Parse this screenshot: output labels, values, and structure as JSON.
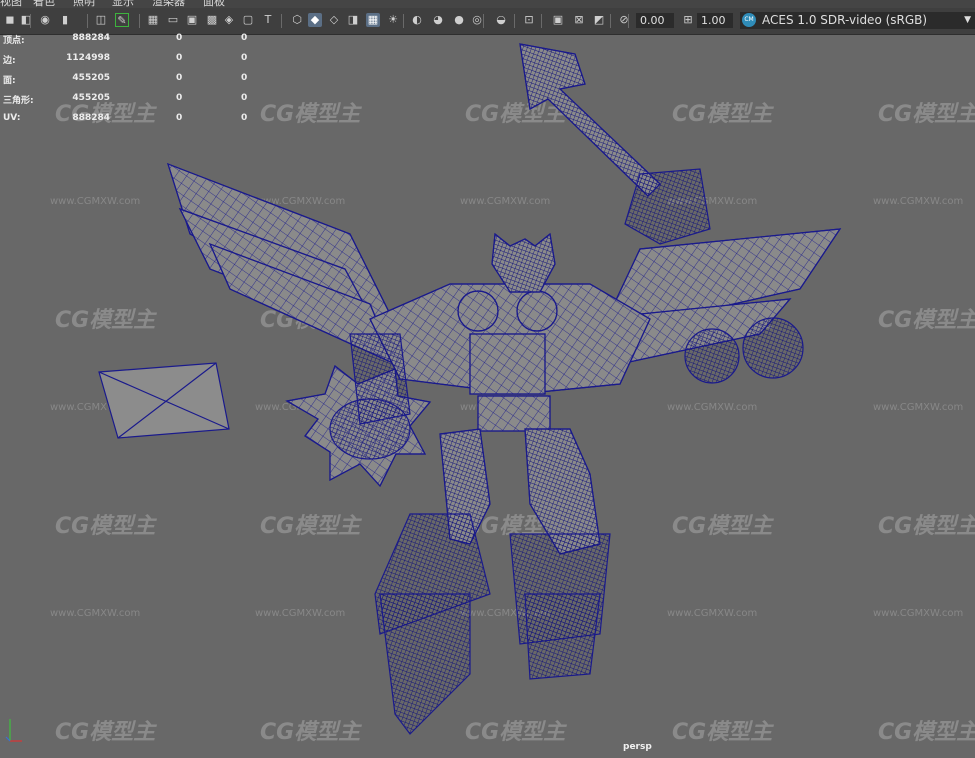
{
  "menubar": {
    "items": [
      "视图",
      "着色",
      "照明",
      "显示",
      "渲染器",
      "面板"
    ]
  },
  "toolbar": {
    "icons": [
      "camera-select-icon",
      "camera-attr-icon",
      "bookmark-icon",
      "image-plane-icon",
      "grid-2d-icon",
      "pencil-icon",
      "grid-icon",
      "film-gate-icon",
      "resolution-gate-icon",
      "gate-mask-icon",
      "field-chart-icon",
      "safe-action-icon",
      "safe-title-icon",
      "wireframe-icon",
      "smooth-shade-icon",
      "default-material-icon",
      "wireframe-on-shaded-icon",
      "textured-icon",
      "lights-icon",
      "shadows-icon",
      "ambient-occlusion-icon",
      "motion-blur-icon",
      "antialias-icon",
      "depth-of-field-icon",
      "isolate-select-icon",
      "xray-icon",
      "xray-joints-icon",
      "backface-icon",
      "exposure-icon",
      "gamma-icon"
    ],
    "exposure": "0.00",
    "gamma": "1.00",
    "color_space": "ACES 1.0 SDR-video (sRGB)",
    "color_mgmt_badge": "CM"
  },
  "hud": {
    "rows": [
      {
        "label": "顶点:",
        "v1": "888284",
        "v2": "0",
        "v3": "0"
      },
      {
        "label": "边:",
        "v1": "1124998",
        "v2": "0",
        "v3": "0"
      },
      {
        "label": "面:",
        "v1": "455205",
        "v2": "0",
        "v3": "0"
      },
      {
        "label": "三角形:",
        "v1": "455205",
        "v2": "0",
        "v3": "0"
      },
      {
        "label": "UV:",
        "v1": "888284",
        "v2": "0",
        "v3": "0"
      }
    ]
  },
  "viewport": {
    "camera": "persp",
    "wire_color": "#1a1a8c",
    "mesh_color": "#8a8a8a",
    "background": "#686868"
  },
  "watermark": {
    "logo": "CG模型主",
    "url": "www.CGMXW.com"
  }
}
